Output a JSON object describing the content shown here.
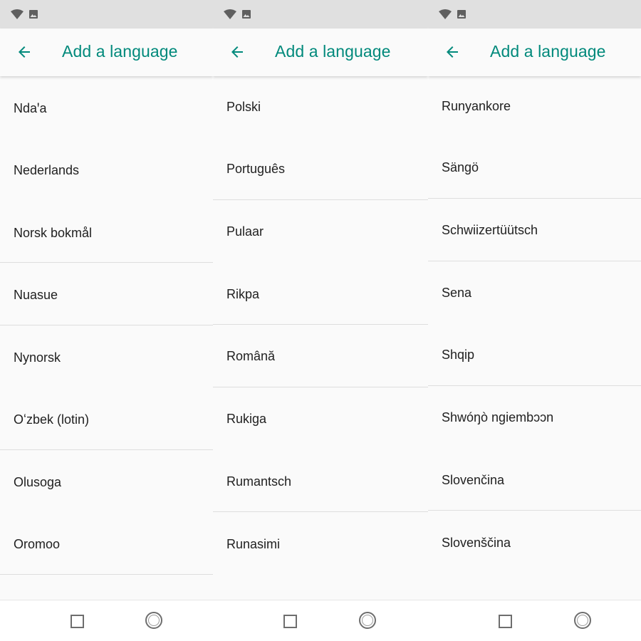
{
  "accent_color": "#00897b",
  "panels": [
    {
      "title": "Add a language",
      "items": [
        "Ndaꞌa",
        "Nederlands",
        "Norsk bokmål",
        "Nuasue",
        "Nynorsk",
        "Oʻzbek (lotin)",
        "Olusoga",
        "Oromoo"
      ]
    },
    {
      "title": "Add a language",
      "items": [
        "Polski",
        "Português",
        "Pulaar",
        "Rikpa",
        "Română",
        "Rukiga",
        "Rumantsch",
        "Runasimi"
      ]
    },
    {
      "title": "Add a language",
      "items": [
        "Runyankore",
        "Sängö",
        "Schwiizertüütsch",
        "Sena",
        "Shqip",
        "Shwóŋò ngiembɔɔn",
        "Slovenčina",
        "Slovenščina"
      ]
    }
  ],
  "icons": {
    "status": [
      "wifi-icon",
      "image-icon"
    ],
    "appbar": "back-arrow-icon",
    "navbar": [
      "recents-square-icon",
      "home-circle-icon"
    ]
  }
}
